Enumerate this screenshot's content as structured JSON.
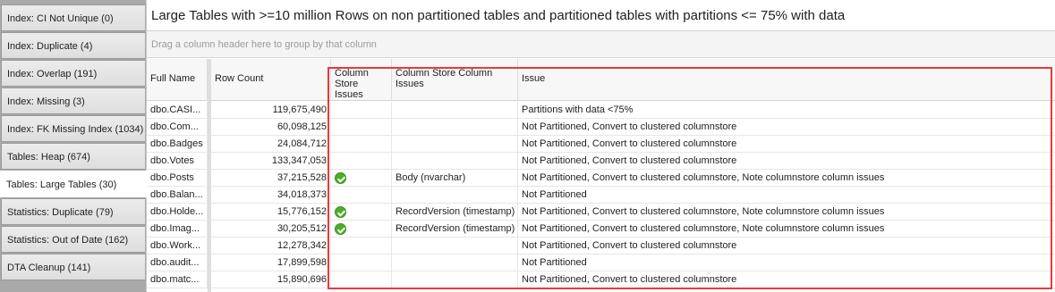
{
  "sidebar": {
    "tabs": [
      {
        "label": "Index: CI Not Unique (0)",
        "active": false
      },
      {
        "label": "Index: Duplicate (4)",
        "active": false
      },
      {
        "label": "Index: Overlap (191)",
        "active": false
      },
      {
        "label": "Index: Missing (3)",
        "active": false
      },
      {
        "label": "Index: FK Missing Index (1034)",
        "active": false
      },
      {
        "label": "Tables: Heap (674)",
        "active": false
      },
      {
        "label": "Tables: Large Tables (30)",
        "active": true
      },
      {
        "label": "Statistics: Duplicate (79)",
        "active": false
      },
      {
        "label": "Statistics: Out of Date (162)",
        "active": false
      },
      {
        "label": "DTA Cleanup (141)",
        "active": false
      }
    ]
  },
  "main": {
    "title": "Large Tables with >=10 million Rows on non partitioned tables and partitioned tables with partitions  <= 75% with data",
    "group_panel_text": "Drag a column header here to group by that column"
  },
  "grid": {
    "columns": {
      "full_name": "Full Name",
      "row_count": "Row Count",
      "cs_issues": "Column Store Issues",
      "cs_column_issues": "Column Store Column Issues",
      "issue": "Issue"
    },
    "rows": [
      {
        "full_name": "dbo.CASI...",
        "row_count": "119,675,490",
        "cs_issue": false,
        "cs_column_issue": "",
        "issue": "Partitions with data <75%"
      },
      {
        "full_name": "dbo.Com...",
        "row_count": "60,098,125",
        "cs_issue": false,
        "cs_column_issue": "",
        "issue": "Not Partitioned, Convert to clustered columnstore"
      },
      {
        "full_name": "dbo.Badges",
        "row_count": "24,084,712",
        "cs_issue": false,
        "cs_column_issue": "",
        "issue": "Not Partitioned, Convert to clustered columnstore"
      },
      {
        "full_name": "dbo.Votes",
        "row_count": "133,347,053",
        "cs_issue": false,
        "cs_column_issue": "",
        "issue": "Not Partitioned, Convert to clustered columnstore"
      },
      {
        "full_name": "dbo.Posts",
        "row_count": "37,215,528",
        "cs_issue": true,
        "cs_column_issue": "Body (nvarchar)",
        "issue": "Not Partitioned, Convert to clustered columnstore, Note columnstore column issues"
      },
      {
        "full_name": "dbo.Balan...",
        "row_count": "34,018,373",
        "cs_issue": false,
        "cs_column_issue": "",
        "issue": "Not Partitioned"
      },
      {
        "full_name": "dbo.Holde...",
        "row_count": "15,776,152",
        "cs_issue": true,
        "cs_column_issue": "RecordVersion (timestamp)",
        "issue": "Not Partitioned, Convert to clustered columnstore, Note columnstore column issues"
      },
      {
        "full_name": "dbo.Imag...",
        "row_count": "30,205,512",
        "cs_issue": true,
        "cs_column_issue": "RecordVersion (timestamp)",
        "issue": "Not Partitioned, Convert to clustered columnstore, Note columnstore column issues"
      },
      {
        "full_name": "dbo.Work...",
        "row_count": "12,278,342",
        "cs_issue": false,
        "cs_column_issue": "",
        "issue": "Not Partitioned, Convert to clustered columnstore"
      },
      {
        "full_name": "dbo.audit...",
        "row_count": "17,899,598",
        "cs_issue": false,
        "cs_column_issue": "",
        "issue": "Not Partitioned"
      },
      {
        "full_name": "dbo.matc...",
        "row_count": "15,890,696",
        "cs_issue": false,
        "cs_column_issue": "",
        "issue": "Not Partitioned, Convert to clustered columnstore"
      }
    ]
  },
  "colors": {
    "highlight_border": "#e8383d",
    "check_green": "#4caf2a"
  }
}
